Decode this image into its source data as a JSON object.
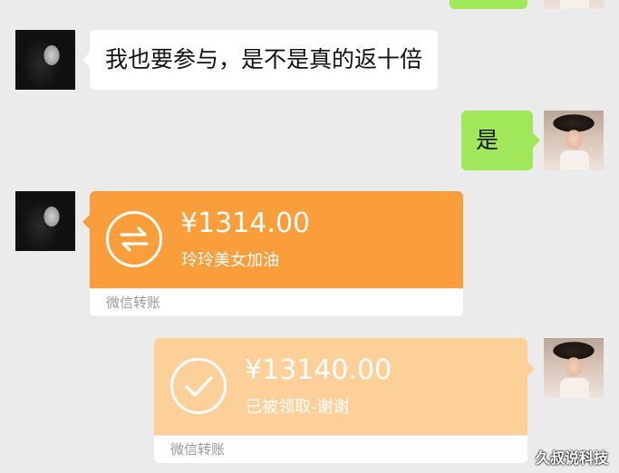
{
  "messages": {
    "m1_text": "我也要参与，是不是真的返十倍",
    "m2_text": "是"
  },
  "transfers": {
    "t1": {
      "amount": "¥1314.00",
      "note": "玲玲美女加油",
      "footer": "微信转账",
      "icon": "transfer-arrows-icon",
      "color": "#fa9d3b"
    },
    "t2": {
      "amount": "¥13140.00",
      "note": "已被领取-谢谢",
      "footer": "微信转账",
      "icon": "checkmark-icon",
      "color": "#fdd09a"
    }
  },
  "watermark": "久叔说科技",
  "colors": {
    "background": "#ebebeb",
    "sent_bubble": "#a0e75a",
    "received_bubble": "#ffffff"
  }
}
